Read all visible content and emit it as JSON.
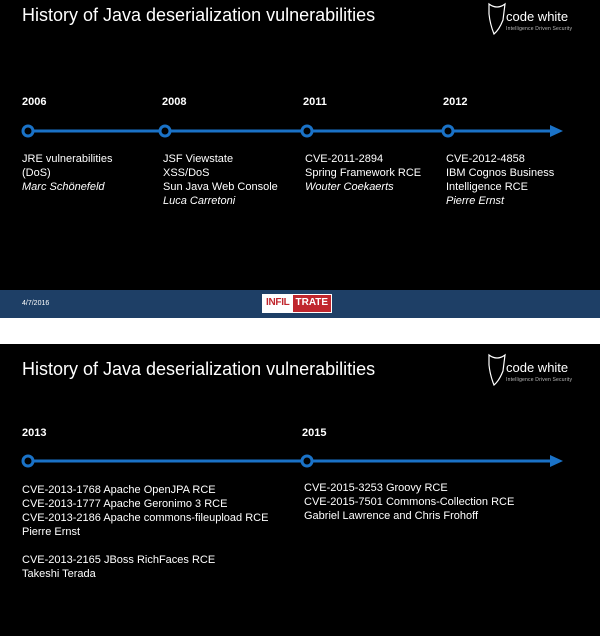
{
  "slides": [
    {
      "title": "History of Java deserialization vulnerabilities",
      "logo": {
        "name": "code white",
        "tagline": "Intelligence Driven Security"
      },
      "years": [
        "2006",
        "2008",
        "2011",
        "2012"
      ],
      "entries": [
        {
          "lines": [
            "JRE vulnerabilities",
            "(DoS)"
          ],
          "author": "Marc Schönefeld"
        },
        {
          "lines": [
            "JSF Viewstate",
            "XSS/DoS",
            "Sun Java Web Console"
          ],
          "author": "Luca Carretoni"
        },
        {
          "lines": [
            "CVE-2011-2894",
            "Spring Framework RCE"
          ],
          "author": "Wouter Coekaerts"
        },
        {
          "lines": [
            "CVE-2012-4858",
            "IBM Cognos Business",
            "Intelligence RCE"
          ],
          "author": "Pierre Ernst"
        }
      ],
      "footer": {
        "date": "4/7/2016",
        "brand_a": "INFIL",
        "brand_b": "TRATE"
      }
    },
    {
      "title": "History of Java deserialization vulnerabilities",
      "logo": {
        "name": "code white",
        "tagline": "Intelligence Driven Security"
      },
      "years": [
        "2013",
        "2015"
      ],
      "entries": [
        {
          "lines": [
            "CVE-2013-1768 Apache OpenJPA RCE",
            "CVE-2013-1777 Apache Geronimo 3 RCE",
            "CVE-2013-2186 Apache commons-fileupload RCE",
            "Pierre Ernst"
          ]
        },
        {
          "lines": [
            "CVE-2013-2165 JBoss RichFaces RCE",
            "Takeshi Terada"
          ]
        },
        {
          "lines": [
            "CVE-2015-3253 Groovy RCE",
            "CVE-2015-7501 Commons-Collection RCE",
            "Gabriel Lawrence and Chris Frohoff"
          ]
        }
      ]
    }
  ],
  "colors": {
    "timeline": "#1a72c7",
    "background": "#000000",
    "footer": "#1e3f66",
    "brand_red": "#c0262d"
  }
}
